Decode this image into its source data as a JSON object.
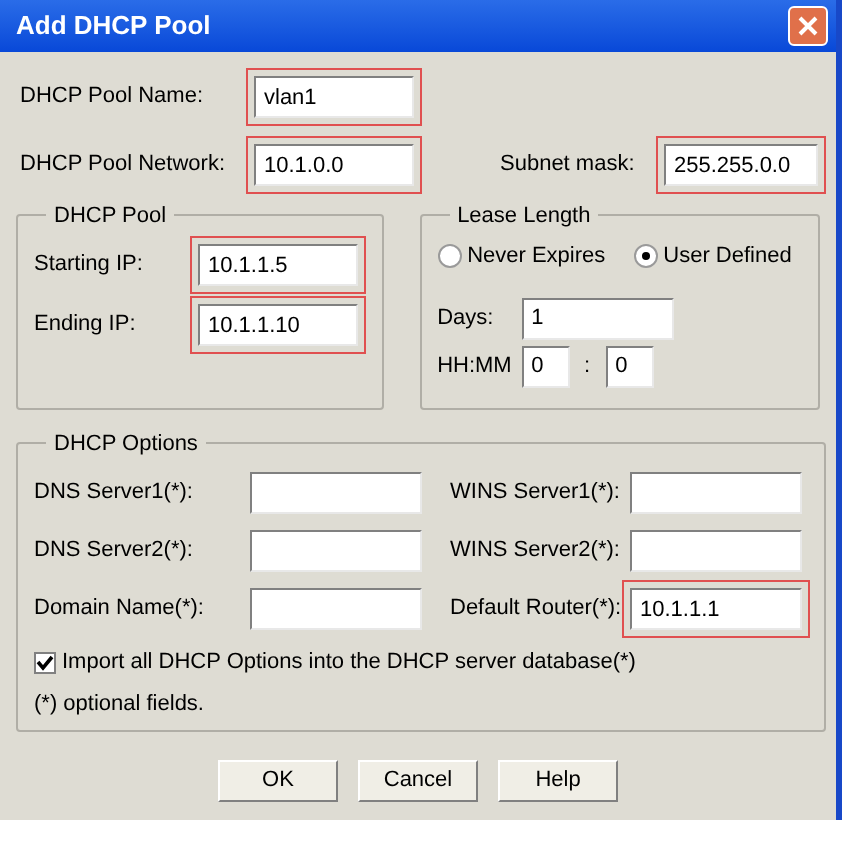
{
  "window": {
    "title": "Add DHCP Pool"
  },
  "pool_name": {
    "label": "DHCP Pool Name:",
    "value": "vlan1",
    "highlighted": true
  },
  "pool_network": {
    "label": "DHCP Pool Network:",
    "value": "10.1.0.0",
    "highlighted": true
  },
  "subnet_mask": {
    "label": "Subnet mask:",
    "value": "255.255.0.0",
    "highlighted": true
  },
  "dhcp_pool": {
    "title": "DHCP Pool",
    "fields": [
      {
        "label": "Starting IP:",
        "value": "10.1.1.5",
        "highlighted": true
      },
      {
        "label": "Ending IP:",
        "value": "10.1.1.10",
        "highlighted": true
      }
    ]
  },
  "lease_length": {
    "title": "Lease Length",
    "options": [
      {
        "label": "Never Expires",
        "selected": false
      },
      {
        "label": "User Defined",
        "selected": true
      }
    ],
    "days": {
      "label": "Days:",
      "value": "1"
    },
    "hhmm": {
      "label": "HH:MM",
      "hours": "0",
      "separator": ":",
      "minutes": "0"
    }
  },
  "dhcp_options": {
    "title": "DHCP Options",
    "fields": [
      {
        "label": "DNS Server1(*):",
        "highlighted": false
      },
      {
        "label": "WINS Server1(*):",
        "highlighted": false
      },
      {
        "label": "DNS Server2(*):",
        "highlighted": false
      },
      {
        "label": "WINS Server2(*):",
        "highlighted": false
      },
      {
        "label": "Domain Name(*):",
        "highlighted": false
      },
      {
        "label": "Default Router(*):",
        "value": "10.1.1.1",
        "highlighted": true
      }
    ],
    "import": {
      "label": "Import all DHCP Options into the DHCP server database(*)",
      "checked": true
    },
    "note": "(*) optional fields."
  },
  "buttons": [
    "OK",
    "Cancel",
    "Help"
  ]
}
